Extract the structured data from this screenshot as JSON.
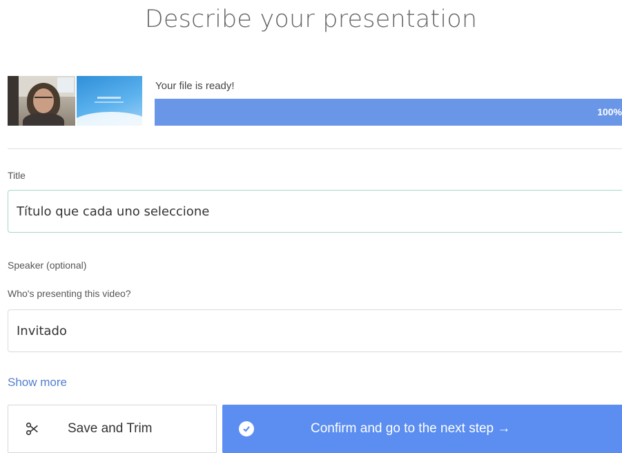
{
  "page": {
    "title": "Describe your presentation"
  },
  "upload": {
    "status_text": "Your file is ready!",
    "progress_label": "100%",
    "progress_value": 100
  },
  "form": {
    "title_label": "Title",
    "title_value": "Título que cada uno seleccione",
    "speaker_label": "Speaker (optional)",
    "speaker_helper": "Who's presenting this video?",
    "speaker_value": "Invitado",
    "show_more": "Show more"
  },
  "actions": {
    "save_trim_label": "Save and Trim",
    "save_trim_icon": "scissors-icon",
    "confirm_label": "Confirm and go to the next step →",
    "confirm_icon": "check-circle-icon"
  },
  "colors": {
    "accent": "#5b8ef0",
    "progress": "#6a96e8",
    "link": "#4f7fcf",
    "focus_border": "#9fd9c9"
  }
}
